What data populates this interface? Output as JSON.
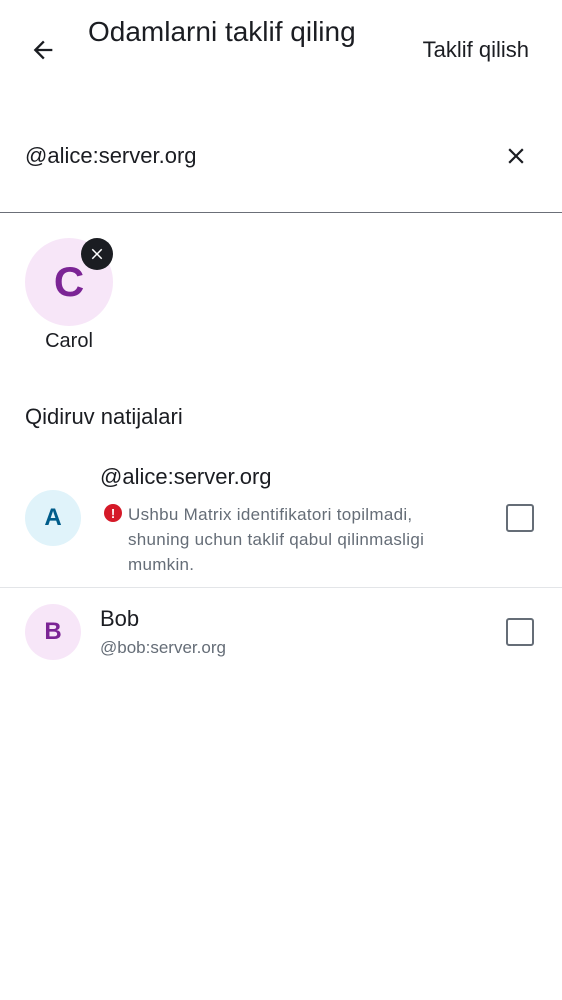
{
  "header": {
    "title": "Odamlarni taklif qiling",
    "invite_action": "Taklif qilish"
  },
  "search": {
    "value": "@alice:server.org"
  },
  "selected": [
    {
      "initial": "C",
      "name": "Carol"
    }
  ],
  "results": {
    "heading": "Qidiruv natijalari",
    "items": [
      {
        "initial": "A",
        "title": "@alice:server.org",
        "warning": "Ushbu Matrix identifikatori topilmadi, shuning uchun taklif qabul qilinmasligi mumkin.",
        "checked": false
      },
      {
        "initial": "B",
        "title": "Bob",
        "subtitle": "@bob:server.org",
        "checked": false
      }
    ]
  },
  "icons": {
    "back": "arrow-back-icon",
    "clear": "close-icon",
    "remove": "close-icon",
    "warning": "error-icon"
  },
  "colors": {
    "avatar_purple_bg": "#f7e6f8",
    "avatar_purple_fg": "#7b2495",
    "avatar_blue_bg": "#e0f3fa",
    "avatar_blue_fg": "#005c8a",
    "error": "#d51928"
  }
}
